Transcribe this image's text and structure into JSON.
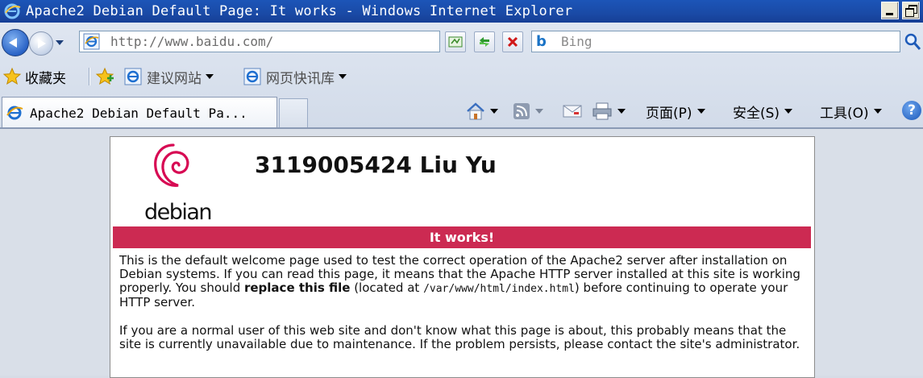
{
  "window": {
    "title": "Apache2 Debian Default Page: It works - Windows Internet Explorer"
  },
  "nav": {
    "url": "http://www.baidu.com/",
    "search_placeholder": "Bing"
  },
  "favorites": {
    "label": "收藏夹",
    "items": [
      {
        "label": "建议网站"
      },
      {
        "label": "网页快讯库"
      }
    ]
  },
  "tabs": [
    {
      "title": "Apache2 Debian Default Pa..."
    }
  ],
  "commands": {
    "page": "页面(P)",
    "safety": "安全(S)",
    "tools": "工具(O)",
    "help": "?"
  },
  "content": {
    "logo_text": "debian",
    "heading": "3119005424 Liu Yu",
    "banner": "It works!",
    "p1_text_a": "This is the default welcome page used to test the correct operation of the Apache2 server after installation on Debian systems. If you can read this page, it means that the Apache HTTP server installed at this site is working properly. You should ",
    "p1_bold": "replace this file",
    "p1_text_b": " (located at ",
    "p1_code": "/var/www/html/index.html",
    "p1_text_c": ") before continuing to operate your HTTP server.",
    "p2": "If you are a normal user of this web site and don't know what this page is about, this probably means that the site is currently unavailable due to maintenance. If the problem persists, please contact the site's administrator."
  },
  "colors": {
    "banner": "#cc2a52",
    "debian_red": "#d70a53",
    "titlebar": "#1a4aa6"
  }
}
